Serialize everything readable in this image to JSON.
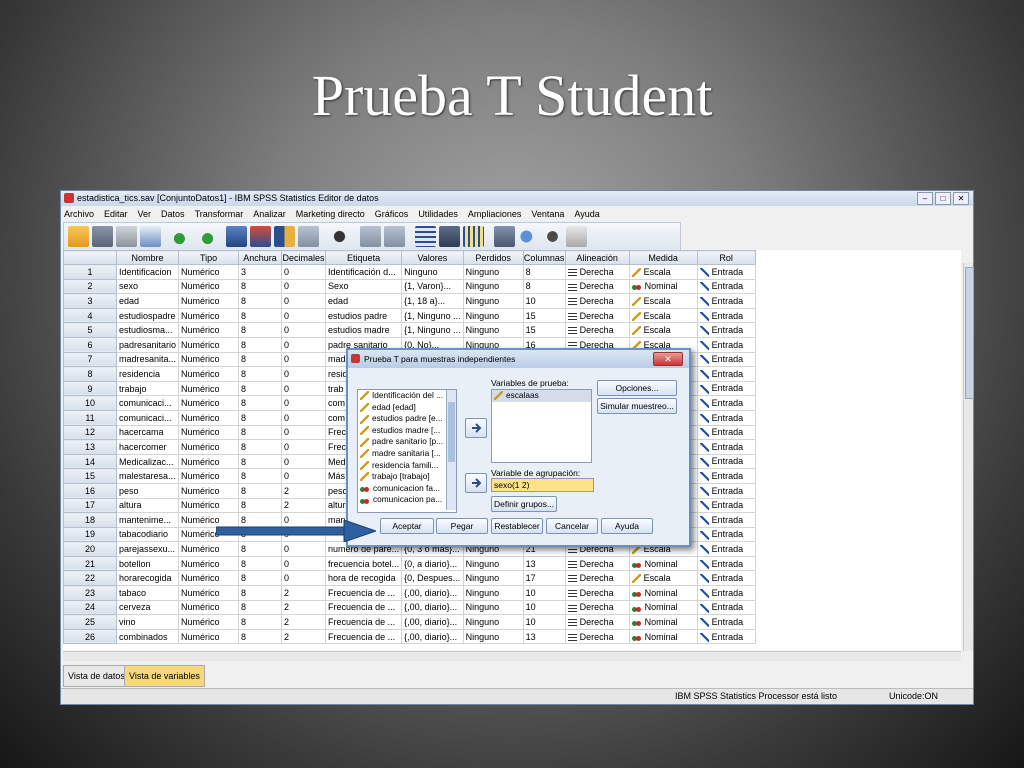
{
  "slide": {
    "title": "Prueba T Student"
  },
  "window": {
    "title": "estadistica_tics.sav [ConjuntoDatos1] - IBM SPSS Statistics Editor de datos",
    "menu": [
      "Archivo",
      "Editar",
      "Ver",
      "Datos",
      "Transformar",
      "Analizar",
      "Marketing directo",
      "Gráficos",
      "Utilidades",
      "Ampliaciones",
      "Ventana",
      "Ayuda"
    ],
    "columns": [
      "Nombre",
      "Tipo",
      "Anchura",
      "Decimales",
      "Etiqueta",
      "Valores",
      "Perdidos",
      "Columnas",
      "Alineación",
      "Medida",
      "Rol"
    ],
    "rows": [
      {
        "n": "1",
        "nombre": "Identificacion",
        "tipo": "Numérico",
        "anchura": "3",
        "decimales": "0",
        "etiqueta": "Identificación d...",
        "valores": "Ninguno",
        "perdidos": "Ninguno",
        "columnas": "8",
        "alineacion": "Derecha",
        "medida": "Escala",
        "rol": "Entrada"
      },
      {
        "n": "2",
        "nombre": "sexo",
        "tipo": "Numérico",
        "anchura": "8",
        "decimales": "0",
        "etiqueta": "Sexo",
        "valores": "{1, Varon}...",
        "perdidos": "Ninguno",
        "columnas": "8",
        "alineacion": "Derecha",
        "medida": "Nominal",
        "rol": "Entrada"
      },
      {
        "n": "3",
        "nombre": "edad",
        "tipo": "Numérico",
        "anchura": "8",
        "decimales": "0",
        "etiqueta": "edad",
        "valores": "{1, 18 a}...",
        "perdidos": "Ninguno",
        "columnas": "10",
        "alineacion": "Derecha",
        "medida": "Escala",
        "rol": "Entrada"
      },
      {
        "n": "4",
        "nombre": "estudiospadre",
        "tipo": "Numérico",
        "anchura": "8",
        "decimales": "0",
        "etiqueta": "estudios padre",
        "valores": "{1, Ninguno ...",
        "perdidos": "Ninguno",
        "columnas": "15",
        "alineacion": "Derecha",
        "medida": "Escala",
        "rol": "Entrada"
      },
      {
        "n": "5",
        "nombre": "estudiosma...",
        "tipo": "Numérico",
        "anchura": "8",
        "decimales": "0",
        "etiqueta": "estudios madre",
        "valores": "{1, Ninguno ...",
        "perdidos": "Ninguno",
        "columnas": "15",
        "alineacion": "Derecha",
        "medida": "Escala",
        "rol": "Entrada"
      },
      {
        "n": "6",
        "nombre": "padresanitario",
        "tipo": "Numérico",
        "anchura": "8",
        "decimales": "0",
        "etiqueta": "padre sanitario",
        "valores": "{0, No}...",
        "perdidos": "Ninguno",
        "columnas": "16",
        "alineacion": "Derecha",
        "medida": "Escala",
        "rol": "Entrada"
      },
      {
        "n": "7",
        "nombre": "madresanita...",
        "tipo": "Numérico",
        "anchura": "8",
        "decimales": "0",
        "etiqueta": "madr",
        "valores": "",
        "perdidos": "",
        "columnas": "",
        "alineacion": "Derecha",
        "medida": "",
        "rol": "Entrada"
      },
      {
        "n": "8",
        "nombre": "residencia",
        "tipo": "Numérico",
        "anchura": "8",
        "decimales": "0",
        "etiqueta": "resid",
        "valores": "",
        "perdidos": "",
        "columnas": "",
        "alineacion": "",
        "medida": "",
        "rol": "Entrada"
      },
      {
        "n": "9",
        "nombre": "trabajo",
        "tipo": "Numérico",
        "anchura": "8",
        "decimales": "0",
        "etiqueta": "trab",
        "valores": "",
        "perdidos": "",
        "columnas": "",
        "alineacion": "",
        "medida": "",
        "rol": "Entrada"
      },
      {
        "n": "10",
        "nombre": "comunicaci...",
        "tipo": "Numérico",
        "anchura": "8",
        "decimales": "0",
        "etiqueta": "com",
        "valores": "",
        "perdidos": "",
        "columnas": "",
        "alineacion": "",
        "medida": "",
        "rol": "Entrada"
      },
      {
        "n": "11",
        "nombre": "comunicaci...",
        "tipo": "Numérico",
        "anchura": "8",
        "decimales": "0",
        "etiqueta": "com",
        "valores": "",
        "perdidos": "",
        "columnas": "",
        "alineacion": "",
        "medida": "",
        "rol": "Entrada"
      },
      {
        "n": "12",
        "nombre": "hacercama",
        "tipo": "Numérico",
        "anchura": "8",
        "decimales": "0",
        "etiqueta": "Frecu",
        "valores": "",
        "perdidos": "",
        "columnas": "",
        "alineacion": "",
        "medida": "",
        "rol": "Entrada"
      },
      {
        "n": "13",
        "nombre": "hacercomer",
        "tipo": "Numérico",
        "anchura": "8",
        "decimales": "0",
        "etiqueta": "Frecu",
        "valores": "",
        "perdidos": "",
        "columnas": "",
        "alineacion": "",
        "medida": "",
        "rol": "Entrada"
      },
      {
        "n": "14",
        "nombre": "Medicalizac...",
        "tipo": "Numérico",
        "anchura": "8",
        "decimales": "0",
        "etiqueta": "Medi",
        "valores": "",
        "perdidos": "",
        "columnas": "",
        "alineacion": "",
        "medida": "",
        "rol": "Entrada"
      },
      {
        "n": "15",
        "nombre": "malestaresa...",
        "tipo": "Numérico",
        "anchura": "8",
        "decimales": "0",
        "etiqueta": "Más",
        "valores": "",
        "perdidos": "",
        "columnas": "",
        "alineacion": "",
        "medida": "",
        "rol": "Entrada"
      },
      {
        "n": "16",
        "nombre": "peso",
        "tipo": "Numérico",
        "anchura": "8",
        "decimales": "2",
        "etiqueta": "peso",
        "valores": "",
        "perdidos": "",
        "columnas": "",
        "alineacion": "",
        "medida": "",
        "rol": "Entrada"
      },
      {
        "n": "17",
        "nombre": "altura",
        "tipo": "Numérico",
        "anchura": "8",
        "decimales": "2",
        "etiqueta": "altura",
        "valores": "",
        "perdidos": "",
        "columnas": "",
        "alineacion": "",
        "medida": "",
        "rol": "Entrada"
      },
      {
        "n": "18",
        "nombre": "mantenime...",
        "tipo": "Numérico",
        "anchura": "8",
        "decimales": "0",
        "etiqueta": "man",
        "valores": "",
        "perdidos": "",
        "columnas": "",
        "alineacion": "",
        "medida": "",
        "rol": "Entrada"
      },
      {
        "n": "19",
        "nombre": "tabacodiario",
        "tipo": "Numérico",
        "anchura": "8",
        "decimales": "0",
        "etiqueta": "",
        "valores": "",
        "perdidos": "",
        "columnas": "",
        "alineacion": "",
        "medida": "",
        "rol": "Entrada"
      },
      {
        "n": "20",
        "nombre": "parejassexu...",
        "tipo": "Numérico",
        "anchura": "8",
        "decimales": "0",
        "etiqueta": "numero de pare...",
        "valores": "{0, 3 o mas}...",
        "perdidos": "Ninguno",
        "columnas": "21",
        "alineacion": "Derecha",
        "medida": "Escala",
        "rol": "Entrada"
      },
      {
        "n": "21",
        "nombre": "botellon",
        "tipo": "Numérico",
        "anchura": "8",
        "decimales": "0",
        "etiqueta": "frecuencia botel...",
        "valores": "{0, a diario}...",
        "perdidos": "Ninguno",
        "columnas": "13",
        "alineacion": "Derecha",
        "medida": "Nominal",
        "rol": "Entrada"
      },
      {
        "n": "22",
        "nombre": "horarecogida",
        "tipo": "Numérico",
        "anchura": "8",
        "decimales": "0",
        "etiqueta": "hora de recogida",
        "valores": "{0, Despues...",
        "perdidos": "Ninguno",
        "columnas": "17",
        "alineacion": "Derecha",
        "medida": "Escala",
        "rol": "Entrada"
      },
      {
        "n": "23",
        "nombre": "tabaco",
        "tipo": "Numérico",
        "anchura": "8",
        "decimales": "2",
        "etiqueta": "Frecuencia de ...",
        "valores": "{,00, diario}...",
        "perdidos": "Ninguno",
        "columnas": "10",
        "alineacion": "Derecha",
        "medida": "Nominal",
        "rol": "Entrada"
      },
      {
        "n": "24",
        "nombre": "cerveza",
        "tipo": "Numérico",
        "anchura": "8",
        "decimales": "2",
        "etiqueta": "Frecuencia de ...",
        "valores": "{,00, diario}...",
        "perdidos": "Ninguno",
        "columnas": "10",
        "alineacion": "Derecha",
        "medida": "Nominal",
        "rol": "Entrada"
      },
      {
        "n": "25",
        "nombre": "vino",
        "tipo": "Numérico",
        "anchura": "8",
        "decimales": "2",
        "etiqueta": "Frecuencia de ...",
        "valores": "{,00, diario}...",
        "perdidos": "Ninguno",
        "columnas": "10",
        "alineacion": "Derecha",
        "medida": "Nominal",
        "rol": "Entrada"
      },
      {
        "n": "26",
        "nombre": "combinados",
        "tipo": "Numérico",
        "anchura": "8",
        "decimales": "2",
        "etiqueta": "Frecuencia de ...",
        "valores": "{,00, diario}...",
        "perdidos": "Ninguno",
        "columnas": "13",
        "alineacion": "Derecha",
        "medida": "Nominal",
        "rol": "Entrada"
      }
    ],
    "tabs": {
      "data_view": "Vista de datos",
      "variable_view": "Vista de variables"
    },
    "status": {
      "processor": "IBM SPSS Statistics Processor está listo",
      "unicode": "Unicode:ON"
    }
  },
  "dialog": {
    "title": "Prueba T para muestras independientes",
    "source_vars": [
      "Identificación del ...",
      "edad [edad]",
      "estudios padre [e...",
      "estudios madre [...",
      "padre sanitario [p...",
      "madre sanitaria [...",
      "residencia famili...",
      "trabajo [trabajo]",
      "comunicacion fa...",
      "comunicacion pa..."
    ],
    "source_icons": [
      "scale",
      "scale",
      "scale",
      "scale",
      "scale",
      "scale",
      "scale",
      "scale",
      "nominal",
      "nominal"
    ],
    "test_vars_label": "Variables de prueba:",
    "test_vars": [
      "escalaas"
    ],
    "group_label": "Variable de agrupación:",
    "group_value": "sexo(1 2)",
    "buttons": {
      "options": "Opciones...",
      "bootstrap": "Simular muestreo...",
      "define_groups": "Definir grupos...",
      "accept": "Aceptar",
      "paste": "Pegar",
      "reset": "Restablecer",
      "cancel": "Cancelar",
      "help": "Ayuda"
    }
  }
}
